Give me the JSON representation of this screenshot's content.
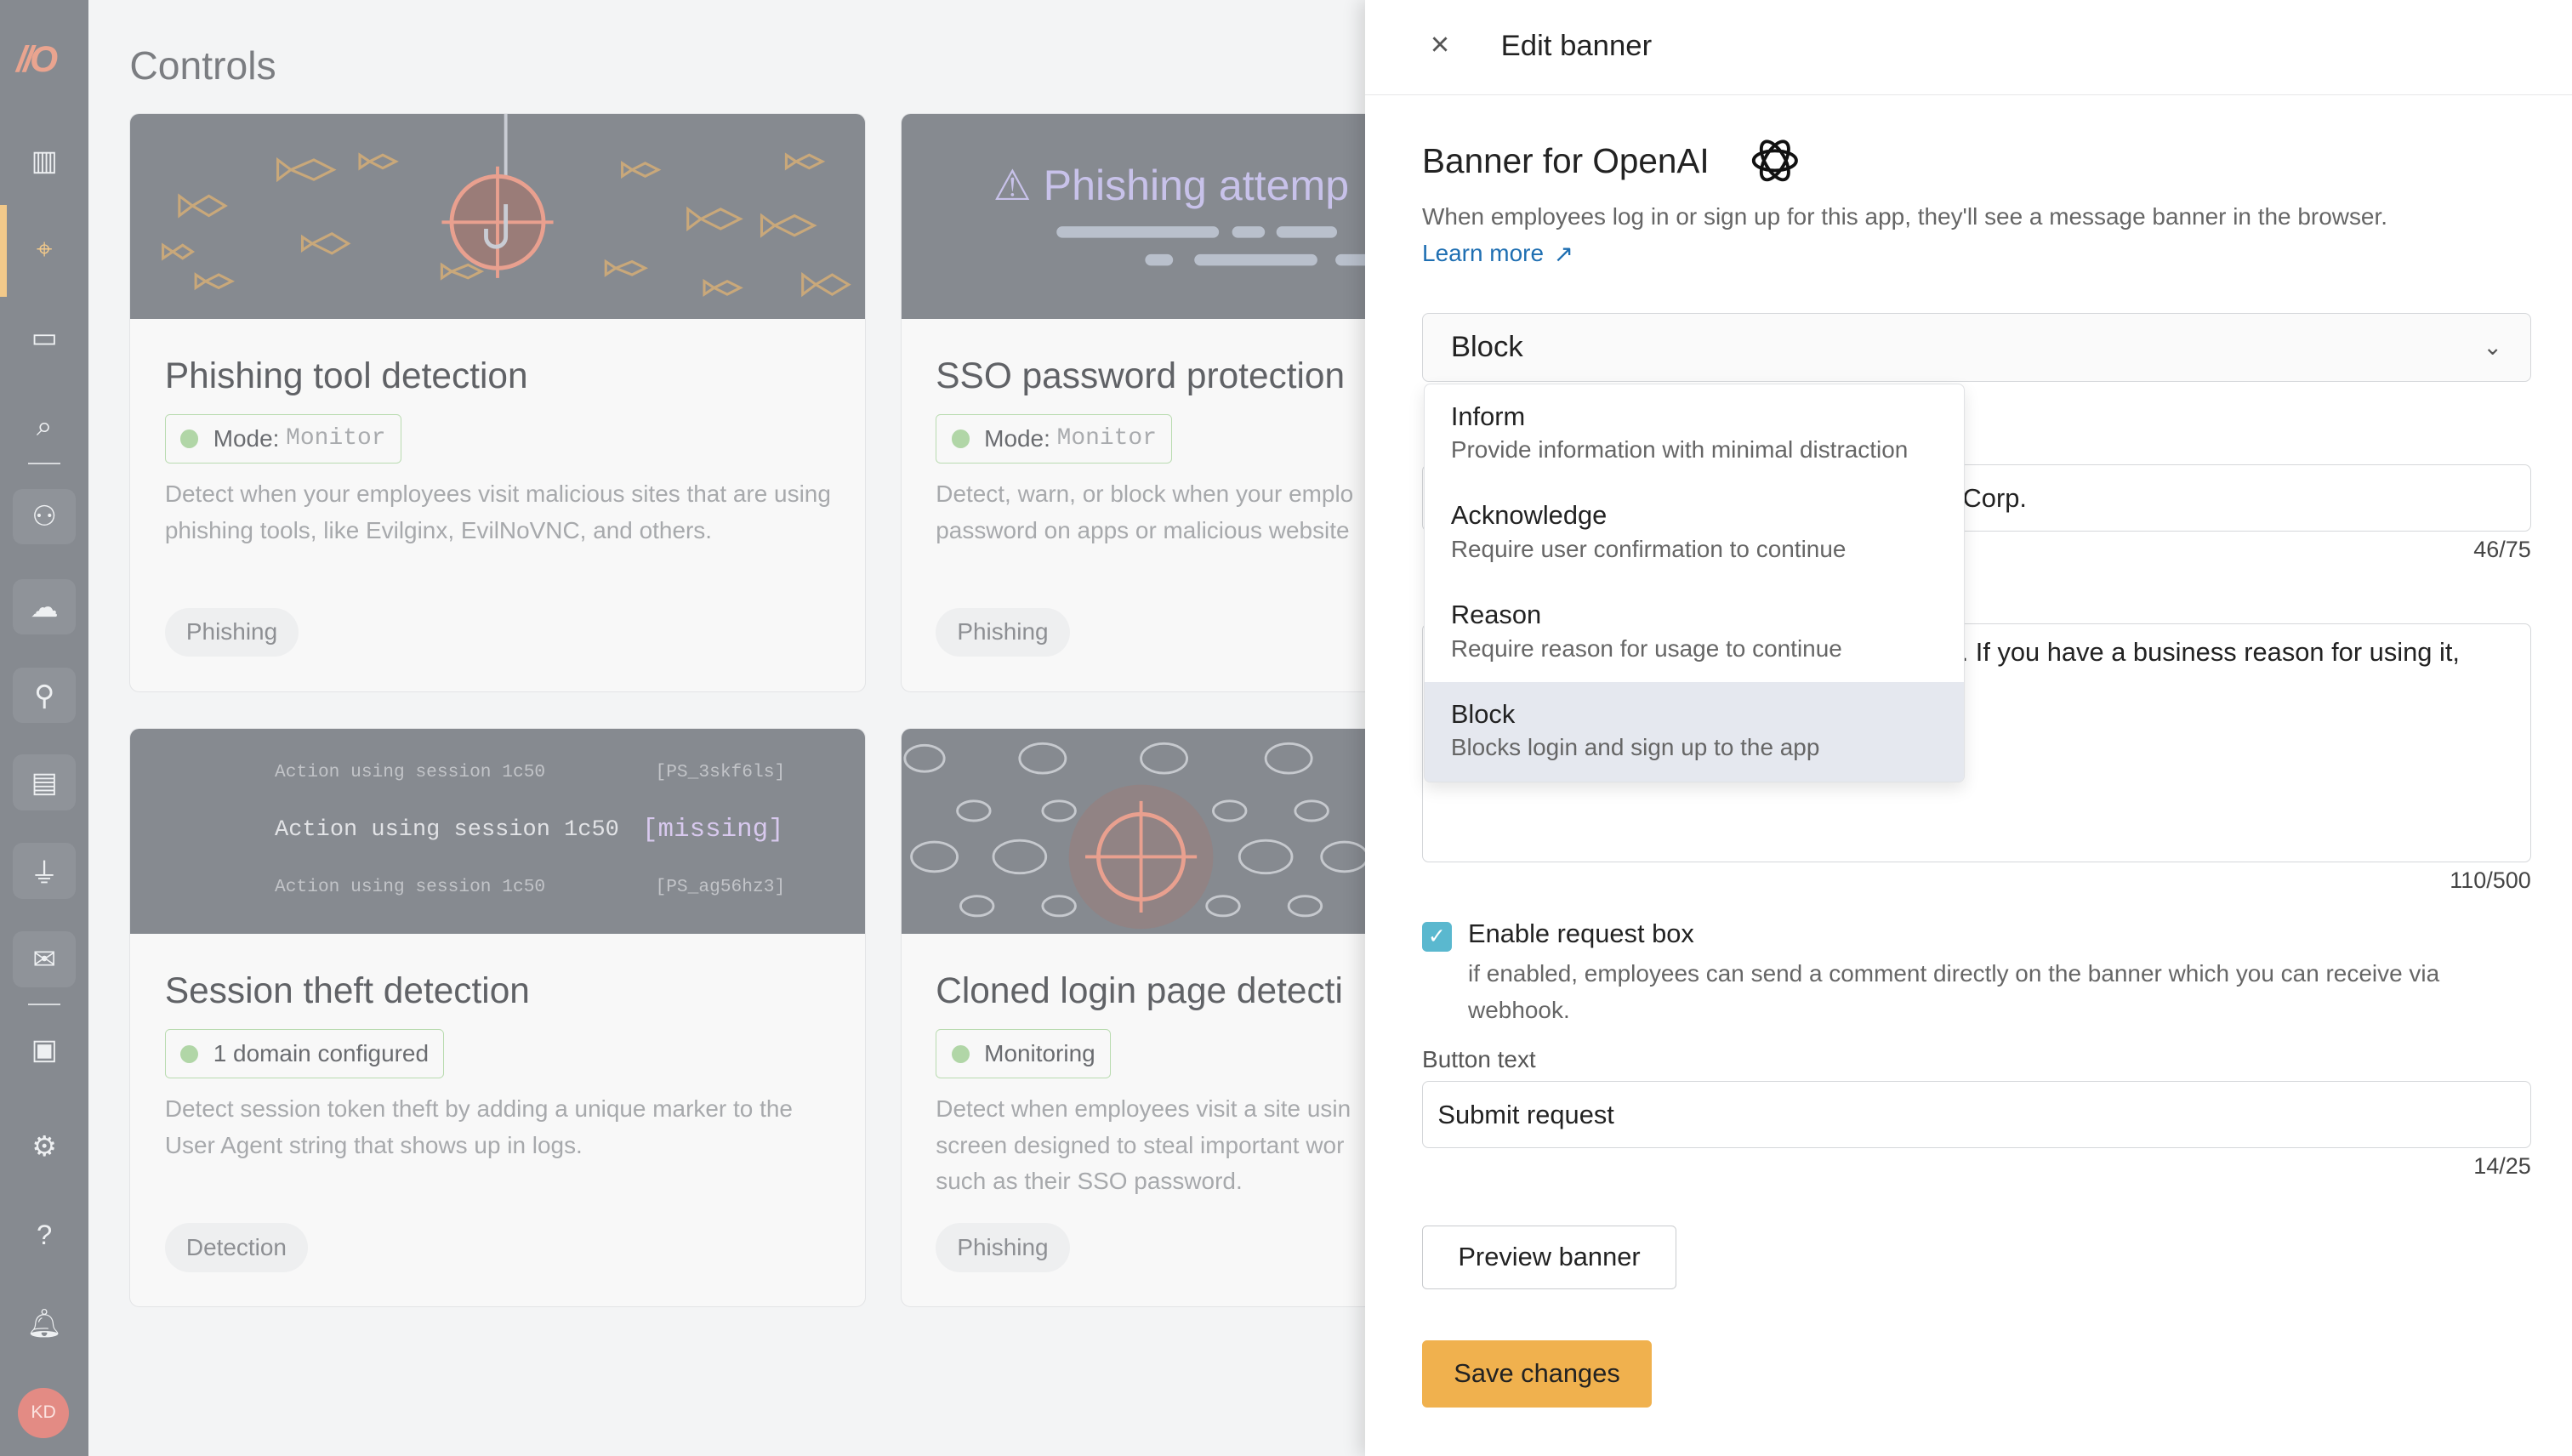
{
  "sidebar": {
    "logo": "//O",
    "avatar": "KD",
    "items": [
      "analytics",
      "controls",
      "monitoring",
      "investigate",
      "users",
      "cloud-apps",
      "identities",
      "browser",
      "integrations",
      "email",
      "device",
      "settings",
      "help",
      "notifications"
    ]
  },
  "main": {
    "title": "Controls",
    "cards": [
      {
        "title": "Phishing tool detection",
        "badge_label": "Mode:",
        "badge_value": "Monitor",
        "desc": "Detect when your employees visit malicious sites that are using phishing tools, like Evilginx, EvilNoVNC, and others.",
        "tag": "Phishing"
      },
      {
        "title": "SSO password protection",
        "badge_label": "Mode:",
        "badge_value": "Monitor",
        "desc": "Detect, warn, or block when your emplo password on apps or malicious website",
        "tag": "Phishing",
        "image_text": "Phishing attemp"
      },
      {
        "title": "Session theft detection",
        "badge_label": "1 domain configured",
        "desc": "Detect session token theft by adding a unique marker to the User Agent string that shows up in logs.",
        "tag": "Detection",
        "image_lines": [
          "Action using session 1c50",
          "[PS_3skf6ls]",
          "Action using session 1c50",
          "[missing]",
          "Action using session 1c50",
          "[PS_ag56hz3]"
        ]
      },
      {
        "title": "Cloned login page detecti",
        "badge_label": "Monitoring",
        "desc": "Detect when employees visit a site usin screen designed to steal important wor such as their SSO password.",
        "tag": "Phishing"
      }
    ]
  },
  "panel": {
    "title": "Edit banner",
    "close": "×",
    "heading": "Banner for OpenAI",
    "description": "When employees log in or sign up for this app, they'll see a message banner in the browser.",
    "learn_more": "Learn more",
    "select_value": "Block",
    "options": [
      {
        "label": "Inform",
        "desc": "Provide information with minimal distraction"
      },
      {
        "label": "Acknowledge",
        "desc": "Require user confirmation to continue"
      },
      {
        "label": "Reason",
        "desc": "Require reason for usage to continue"
      },
      {
        "label": "Block",
        "desc": "Blocks login and sign up to the app"
      }
    ],
    "title_field_visible": "Corp.",
    "title_counter": "46/75",
    "message_visible": ". If you have a business reason for using it,",
    "message_counter": "110/500",
    "request_box_label": "Enable request box",
    "request_box_checked": true,
    "request_box_help": "if enabled, employees can send a comment directly on the banner which you can receive via webhook.",
    "button_text_label": "Button text",
    "button_text_value": "Submit request",
    "button_text_counter": "14/25",
    "preview": "Preview banner",
    "save": "Save changes"
  },
  "colors": {
    "accent": "#f0b14e",
    "checkbox": "#5ab8cf",
    "link": "#1f6fb2",
    "highlight": "#e5e8ef"
  }
}
